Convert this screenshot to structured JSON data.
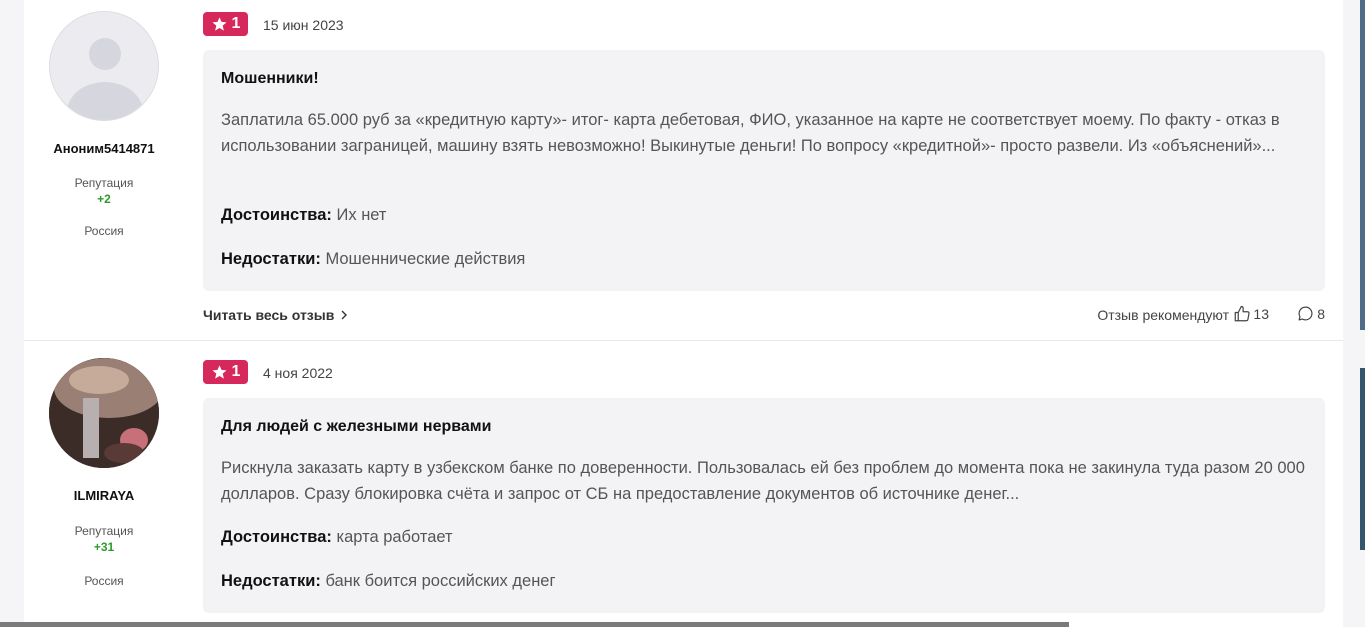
{
  "reviews": [
    {
      "author": {
        "name": "Аноним5414871",
        "reputation_label": "Репутация",
        "reputation_value": "+2",
        "country": "Россия"
      },
      "rating": "1",
      "date": "15 июн 2023",
      "title": "Мошенники!",
      "text": "Заплатила 65.000 руб за «кредитную карту»- итог- карта дебетовая, ФИО, указанное на карте не соответствует моему. По факту - отказ в использовании заграницей, машину взять невозможно! Выкинутые деньги! По вопросу «кредитной»- просто развели. Из «объяснений»...",
      "pros_label": "Достоинства:",
      "pros": "Их нет",
      "cons_label": "Недостатки:",
      "cons": "Мошеннические действия",
      "read_more": "Читать весь отзыв",
      "recommend_label": "Отзыв рекомендуют",
      "likes": "13",
      "comments": "8"
    },
    {
      "author": {
        "name": "ILMIRAYA",
        "reputation_label": "Репутация",
        "reputation_value": "+31",
        "country": "Россия"
      },
      "rating": "1",
      "date": "4 ноя 2022",
      "title": "Для людей с железными нервами",
      "text": "Рискнула заказать карту в узбекском банке по доверенности. Пользовалась ей без проблем до момента пока не закинула туда разом 20 000 долларов. Сразу блокировка счёта и запрос от СБ на предоставление документов об источнике денег...",
      "pros_label": "Достоинства:",
      "pros": "карта работает",
      "cons_label": "Недостатки:",
      "cons": "банк боится российских денег"
    }
  ],
  "colors": {
    "rating_badge": "#d6285b",
    "reputation": "#2e9a2e",
    "card_bg": "#f3f3f5"
  },
  "icons": [
    "star-icon",
    "chevron-right-icon",
    "thumbs-up-icon",
    "comment-icon",
    "default-avatar-icon"
  ]
}
